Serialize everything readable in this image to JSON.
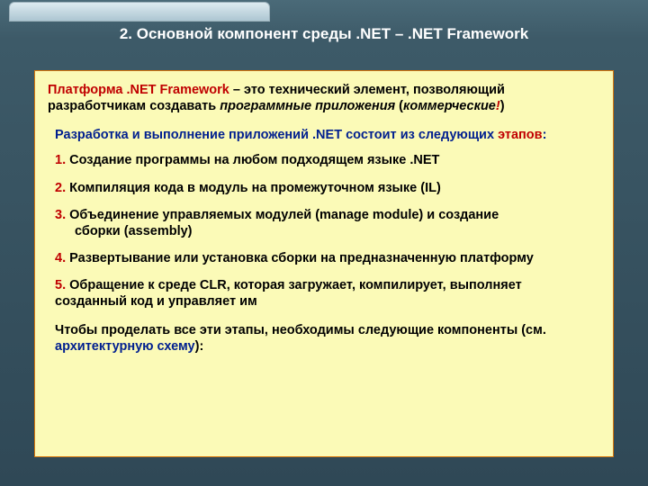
{
  "title": "2. Основной компонент среды .NET – .NET Framework",
  "intro": {
    "lead": "Платформа .NET Framework",
    "rest1": " – это технический элемент, позволяющий разработчикам создавать ",
    "ital1": "программные приложения",
    "paren_open": " (",
    "ital2": "коммерческие",
    "bang": "!",
    "paren_close": ")"
  },
  "subhead": {
    "main": "Разработка и выполнение приложений .NET состоит из следующих ",
    "accent": "этапов",
    "colon": ":"
  },
  "steps": {
    "n1": "1.",
    "t1": " Создание программы на любом подходящем языке .NET",
    "n2": "2.",
    "t2": " Компиляция кода в модуль на промежуточном языке (IL)",
    "n3": "3.",
    "t3a": " Объединение управляемых модулей (manage module) и создание",
    "t3b": "сборки (assembly)",
    "n4": "4.",
    "t4": " Развертывание или установка сборки на предназначенную платформу",
    "n5": "5.",
    "t5a": " Обращение к среде CLR, которая загружает, компилирует, выполняет",
    "t5b": "созданный код и управляет им"
  },
  "foot": {
    "a": "Чтобы проделать все эти этапы, необходимы следующие компоненты (см. ",
    "link": "архитектурную схему",
    "b": "):"
  }
}
